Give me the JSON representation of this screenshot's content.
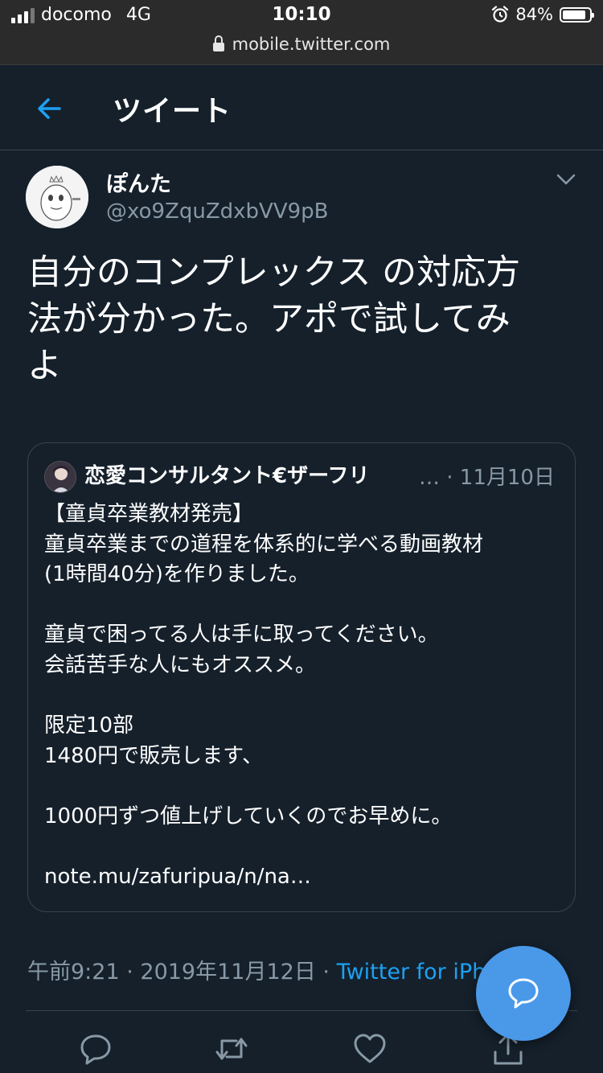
{
  "status_bar": {
    "carrier": "docomo",
    "network": "4G",
    "time": "10:10",
    "battery": "84%"
  },
  "browser": {
    "url": "mobile.twitter.com"
  },
  "header": {
    "title": "ツイート"
  },
  "tweet": {
    "author_name": "ぽんた",
    "author_handle": "@xo9ZquZdxbVV9pB",
    "text": "自分のコンプレックス の対応方\n法が分かった。アポで試してみ\nよ",
    "time": "午前9:21",
    "date": "2019年11月12日",
    "source": "Twitter for iPh",
    "sep": " · "
  },
  "quote": {
    "author_name": "恋愛コンサルタント€ザーフリ",
    "ellipsis": "…",
    "date": " · 11月10日",
    "text": "【童貞卒業教材発売】\n童貞卒業までの道程を体系的に学べる動画教材\n(1時間40分)を作りました。\n\n童貞で困ってる人は手に取ってください。\n会話苦手な人にもオススメ。\n\n限定10部\n1480円で販売します、\n\n1000円ずつ値上げしていくのでお早めに。\n\nnote.mu/zafuripua/n/na…"
  },
  "colors": {
    "background": "#15202b",
    "accent": "#1da1f2",
    "fab": "#4a99e9",
    "muted": "#8899a6",
    "border": "#38444d"
  },
  "icons": [
    "back-arrow-icon",
    "chevron-down-icon",
    "reply-icon",
    "retweet-icon",
    "like-icon",
    "share-icon",
    "compose-icon",
    "lock-icon"
  ]
}
